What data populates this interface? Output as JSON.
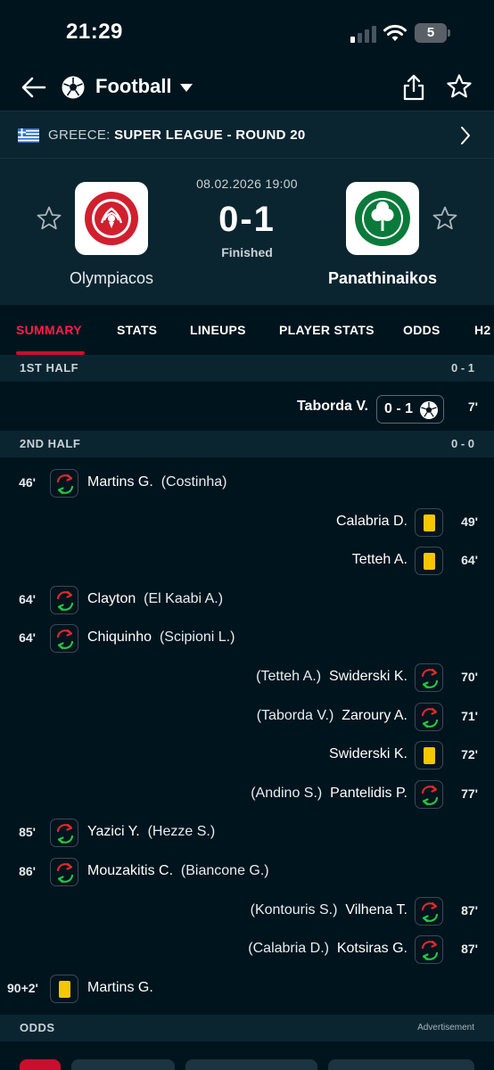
{
  "status_bar": {
    "time": "21:29",
    "battery": "5"
  },
  "header": {
    "sport": "Football"
  },
  "league": {
    "country": "GREECE:",
    "name": "SUPER LEAGUE - ROUND 20"
  },
  "match": {
    "date": "08.02.2026 19:00",
    "score": "0-1",
    "status": "Finished",
    "home_team": "Olympiacos",
    "away_team": "Panathinaikos"
  },
  "tabs": [
    "SUMMARY",
    "STATS",
    "LINEUPS",
    "PLAYER STATS",
    "ODDS",
    "H2"
  ],
  "active_tab": "SUMMARY",
  "sections": {
    "first_half": {
      "label": "1ST HALF",
      "score": "0 - 1"
    },
    "second_half": {
      "label": "2ND HALF",
      "score": "0 - 0"
    }
  },
  "goal": {
    "player": "Taborda V.",
    "score": "0 - 1",
    "minute": "7'"
  },
  "incidents": [
    {
      "side": "home",
      "type": "sub",
      "minute": "46'",
      "in": "Martins G.",
      "out": "(Costinha)"
    },
    {
      "side": "away",
      "type": "yellow",
      "minute": "49'",
      "player": "Calabria D."
    },
    {
      "side": "away",
      "type": "yellow",
      "minute": "64'",
      "player": "Tetteh A."
    },
    {
      "side": "home",
      "type": "sub",
      "minute": "64'",
      "in": "Clayton",
      "out": "(El Kaabi A.)"
    },
    {
      "side": "home",
      "type": "sub",
      "minute": "64'",
      "in": "Chiquinho",
      "out": "(Scipioni L.)"
    },
    {
      "side": "away",
      "type": "sub",
      "minute": "70'",
      "in": "Swiderski K.",
      "out": "(Tetteh A.)"
    },
    {
      "side": "away",
      "type": "sub",
      "minute": "71'",
      "in": "Zaroury A.",
      "out": "(Taborda V.)"
    },
    {
      "side": "away",
      "type": "yellow",
      "minute": "72'",
      "player": "Swiderski K."
    },
    {
      "side": "away",
      "type": "sub",
      "minute": "77'",
      "in": "Pantelidis P.",
      "out": "(Andino S.)"
    },
    {
      "side": "home",
      "type": "sub",
      "minute": "85'",
      "in": "Yazici Y.",
      "out": "(Hezze S.)"
    },
    {
      "side": "home",
      "type": "sub",
      "minute": "86'",
      "in": "Mouzakitis C.",
      "out": "(Biancone G.)"
    },
    {
      "side": "away",
      "type": "sub",
      "minute": "87'",
      "in": "Vilhena T.",
      "out": "(Kontouris S.)"
    },
    {
      "side": "away",
      "type": "sub",
      "minute": "87'",
      "in": "Kotsiras G.",
      "out": "(Calabria D.)"
    },
    {
      "side": "home",
      "type": "yellow",
      "minute": "90+2'",
      "player": "Martins G."
    }
  ],
  "odds": {
    "label": "ODDS",
    "advertisement": "Advertisement"
  },
  "colors": {
    "accent": "#c8102e",
    "background": "#00141e",
    "panel": "#0b2530",
    "yellow_card": "#f6c700",
    "sub_in": "#27c93f",
    "sub_out": "#e02a2a"
  },
  "icons": {
    "back": "arrow-left-icon",
    "sport": "soccer-ball-icon",
    "share": "share-icon",
    "favorite": "star-icon",
    "league_next": "chevron-right-icon",
    "substitution": "substitution-icon",
    "yellow_card": "yellow-card-icon",
    "goal": "soccer-ball-icon"
  }
}
